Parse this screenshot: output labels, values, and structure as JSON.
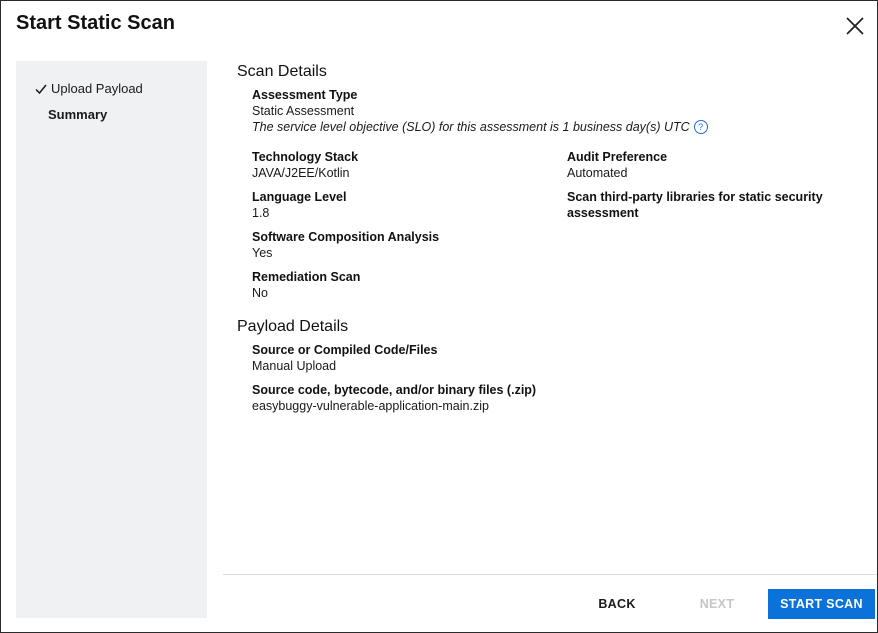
{
  "dialog": {
    "title": "Start Static Scan"
  },
  "sidebar": {
    "steps": [
      {
        "label": "Upload Payload",
        "status": "completed"
      },
      {
        "label": "Summary",
        "status": "active"
      }
    ]
  },
  "scan_details": {
    "heading": "Scan Details",
    "assessment_type_label": "Assessment Type",
    "assessment_type_value": "Static Assessment",
    "slo_text": "The service level objective (SLO) for this assessment is 1 business day(s) UTC",
    "technology_stack_label": "Technology Stack",
    "technology_stack_value": "JAVA/J2EE/Kotlin",
    "language_level_label": "Language Level",
    "language_level_value": "1.8",
    "sca_label": "Software Composition Analysis",
    "sca_value": "Yes",
    "remediation_label": "Remediation Scan",
    "remediation_value": "No",
    "audit_preference_label": "Audit Preference",
    "audit_preference_value": "Automated",
    "third_party_label": "Scan third-party libraries for static security assessment"
  },
  "payload_details": {
    "heading": "Payload Details",
    "source_label": "Source or Compiled Code/Files",
    "source_value": "Manual Upload",
    "files_label": "Source code, bytecode, and/or binary files (.zip)",
    "files_value": "easybuggy-vulnerable-application-main.zip"
  },
  "footer": {
    "back_label": "BACK",
    "next_label": "NEXT",
    "start_label": "START SCAN"
  },
  "colors": {
    "accent": "#0b72d9",
    "disabled": "#c7c7c7",
    "sidebar_bg": "#f0f1f2"
  }
}
